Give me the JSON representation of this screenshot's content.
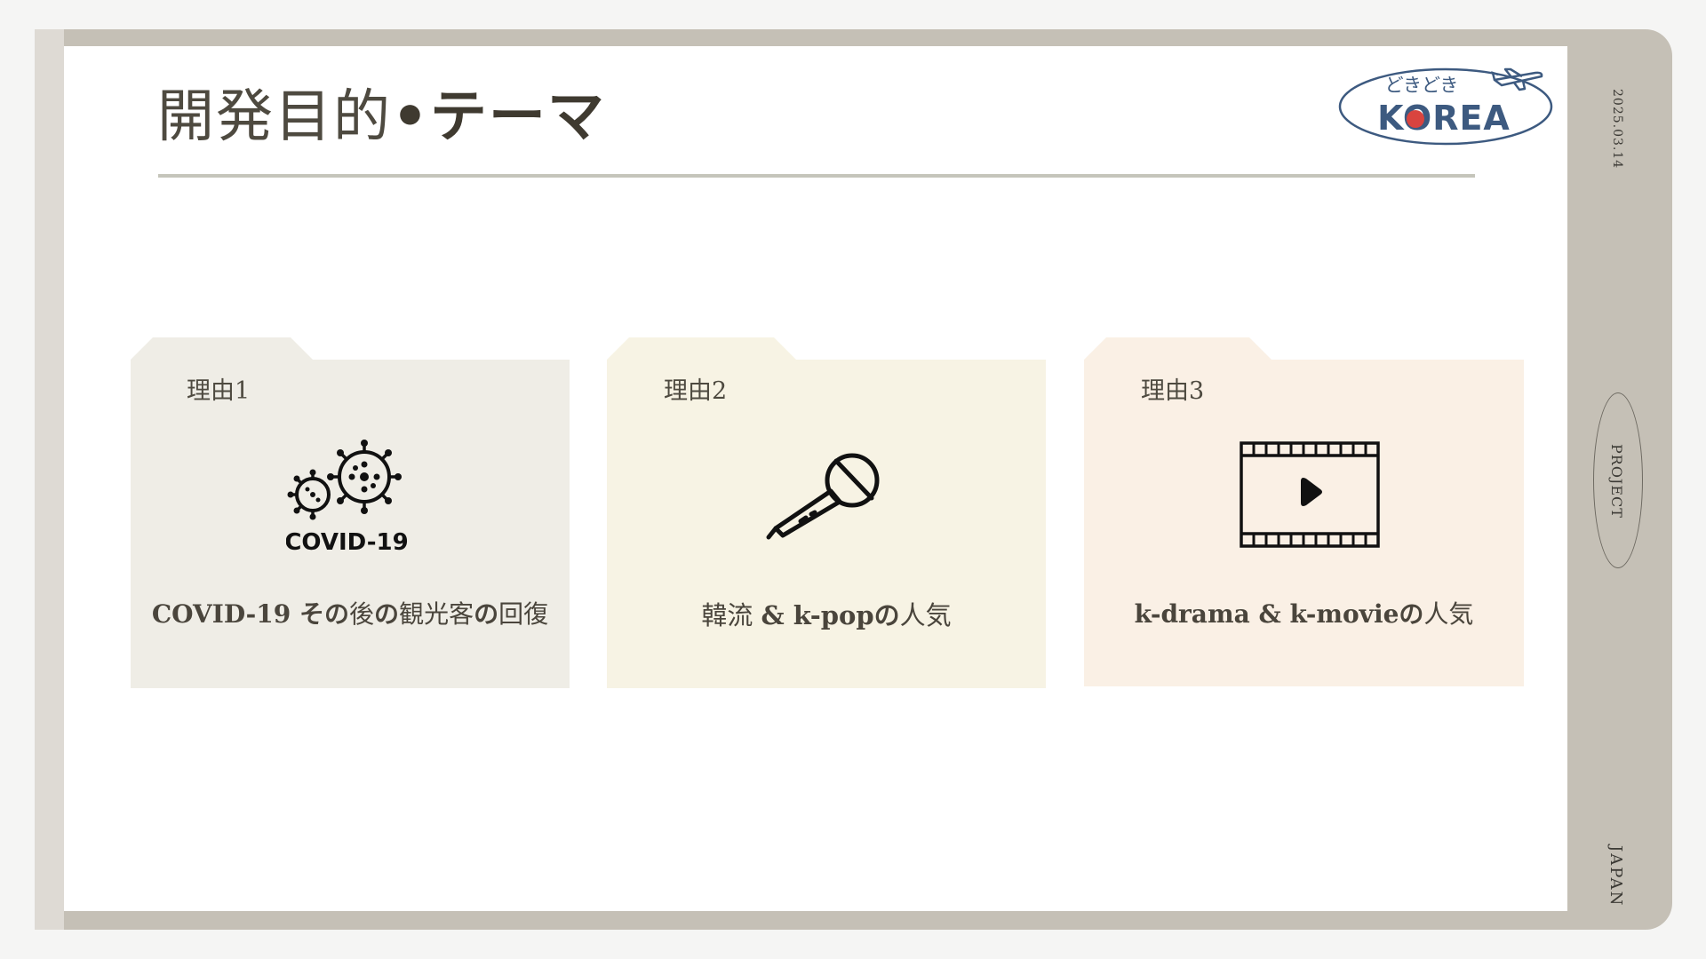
{
  "colors": {
    "frame": "#c5c0b6",
    "frame_strip": "#dedad4",
    "slide": "#ffffff",
    "card1": "#efede6",
    "card2": "#f7f3e4",
    "card3": "#faf0e5",
    "title_text": "#4e4a40",
    "logo_blue": "#3d5a80",
    "logo_red": "#d9443f"
  },
  "title": {
    "normal": "開発目的",
    "bold": "•テーマ"
  },
  "logo": {
    "top_text": "どきどき",
    "main_text": "KOREA",
    "icon": "airplane-icon"
  },
  "side": {
    "date": "2025.03.14",
    "project": "PROJECT",
    "japan": "JAPAN"
  },
  "cards": [
    {
      "label": "理由1",
      "icon": "covid-virus-icon",
      "icon_text": "COVID-19",
      "caption_bold": "COVID-19 その",
      "caption_normal": "後",
      "caption_bold2": "の",
      "caption_normal2": "観光客",
      "caption_bold3": "の",
      "caption_normal3": "回復"
    },
    {
      "label": "理由2",
      "icon": "microphone-icon",
      "caption_normal": "韓流 ",
      "caption_bold": "& k-popの",
      "caption_normal2": "人気"
    },
    {
      "label": "理由3",
      "icon": "film-play-icon",
      "caption_bold": "k-drama & k-movieの",
      "caption_normal": "人気"
    }
  ]
}
